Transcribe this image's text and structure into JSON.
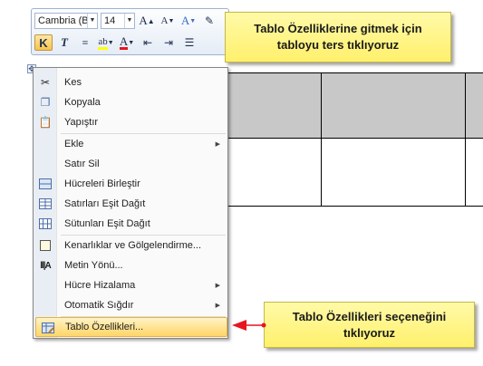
{
  "mini_toolbar": {
    "font_name": "Cambria (B",
    "font_size": "14",
    "grow_font_label": "A",
    "shrink_font_label": "A",
    "bold_label": "K",
    "italic_label": "T",
    "font_color_label": "A"
  },
  "context_menu": {
    "items": [
      {
        "label": "Kes",
        "icon": "scissors-icon"
      },
      {
        "label": "Kopyala",
        "icon": "copy-icon"
      },
      {
        "label": "Yapıştır",
        "icon": "paste-icon"
      },
      {
        "label": "Ekle",
        "icon": "",
        "submenu": true
      },
      {
        "label": "Satır Sil",
        "icon": ""
      },
      {
        "label": "Hücreleri Birleştir",
        "icon": "merge-cells-icon"
      },
      {
        "label": "Satırları Eşit Dağıt",
        "icon": "distribute-rows-icon"
      },
      {
        "label": "Sütunları Eşit Dağıt",
        "icon": "distribute-columns-icon"
      },
      {
        "label": "Kenarlıklar ve Gölgelendirme...",
        "icon": "borders-icon"
      },
      {
        "label": "Metin Yönü...",
        "icon": "text-direction-icon"
      },
      {
        "label": "Hücre Hizalama",
        "icon": "",
        "submenu": true
      },
      {
        "label": "Otomatik Sığdır",
        "icon": "",
        "submenu": true
      },
      {
        "label": "Tablo Özellikleri...",
        "icon": "table-properties-icon"
      }
    ]
  },
  "callouts": {
    "top": {
      "line1": "Tablo Özelliklerine gitmek için",
      "line2": "tabloyu ters tıklıyoruz"
    },
    "bottom": {
      "line1": "Tablo Özellikleri seçeneğini",
      "line2": "tıklıyoruz"
    }
  },
  "colors": {
    "highlight": "#ffd567",
    "callout_bg": "#fff06c",
    "arrow": "#e8141e",
    "table_header_fill": "#c8c8c8"
  }
}
